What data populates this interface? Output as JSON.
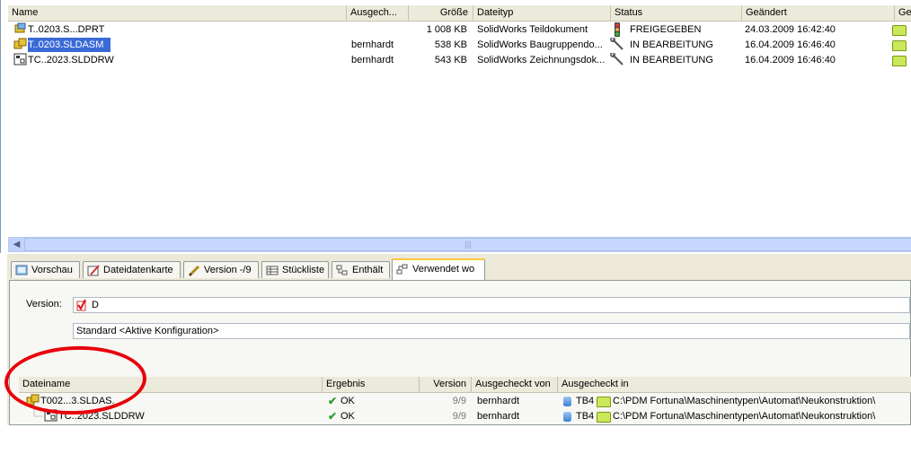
{
  "files_table": {
    "columns": [
      "Name",
      "Ausgech...",
      "Größe",
      "Dateityp",
      "Status",
      "Geändert",
      "Gel"
    ],
    "rows": [
      {
        "name": "T..0203.S...DPRT",
        "checked_out_by": "",
        "size": "1 008 KB",
        "type": "SolidWorks Teildokument",
        "status": "FREIGEGEBEN",
        "status_icon": "traffic-light-icon",
        "modified": "24.03.2009 16:42:40"
      },
      {
        "name": "T..0203.SLDASM",
        "checked_out_by": "bernhardt",
        "size": "538 KB",
        "type": "SolidWorks Baugruppendo...",
        "status": "IN BEARBEITUNG",
        "status_icon": "wrench-icon",
        "modified": "16.04.2009 16:46:40"
      },
      {
        "name": "TC..2023.SLDDRW",
        "checked_out_by": "bernhardt",
        "size": "543 KB",
        "type": "SolidWorks Zeichnungsdok...",
        "status": "IN BEARBEITUNG",
        "status_icon": "wrench-icon",
        "modified": "16.04.2009 16:46:40"
      }
    ]
  },
  "tabs": [
    {
      "label": "Vorschau",
      "icon": "preview-icon",
      "active": false
    },
    {
      "label": "Dateidatenkarte",
      "icon": "datacard-icon",
      "active": false
    },
    {
      "label": "Version -/9",
      "icon": "pencil-icon",
      "active": false
    },
    {
      "label": "Stückliste",
      "icon": "bom-icon",
      "active": false
    },
    {
      "label": "Enthält",
      "icon": "contains-icon",
      "active": false
    },
    {
      "label": "Verwendet wo",
      "icon": "where-used-icon",
      "active": true
    }
  ],
  "version_label": "Version:",
  "version_value": "D",
  "configuration_value": "Standard <Aktive Konfiguration>",
  "where_used_table": {
    "columns": [
      "Dateiname",
      "Ergebnis",
      "Version",
      "Ausgecheckt von",
      "Ausgecheckt in"
    ],
    "rows": [
      {
        "name": "T002...3.SLDAS.",
        "result": "OK",
        "version": "9/9",
        "checked_out_by": "bernhardt",
        "vault": "TB4",
        "path": "C:\\PDM Fortuna\\Maschinentypen\\Automat\\Neukonstruktion\\"
      },
      {
        "name": "TC..2023.SLDDRW",
        "result": "OK",
        "version": "9/9",
        "checked_out_by": "bernhardt",
        "vault": "TB4",
        "path": "C:\\PDM Fortuna\\Maschinentypen\\Automat\\Neukonstruktion\\"
      }
    ]
  },
  "colors": {
    "annotation_circle": "#e8000b",
    "active_tab_accent": "#ffc83c"
  }
}
